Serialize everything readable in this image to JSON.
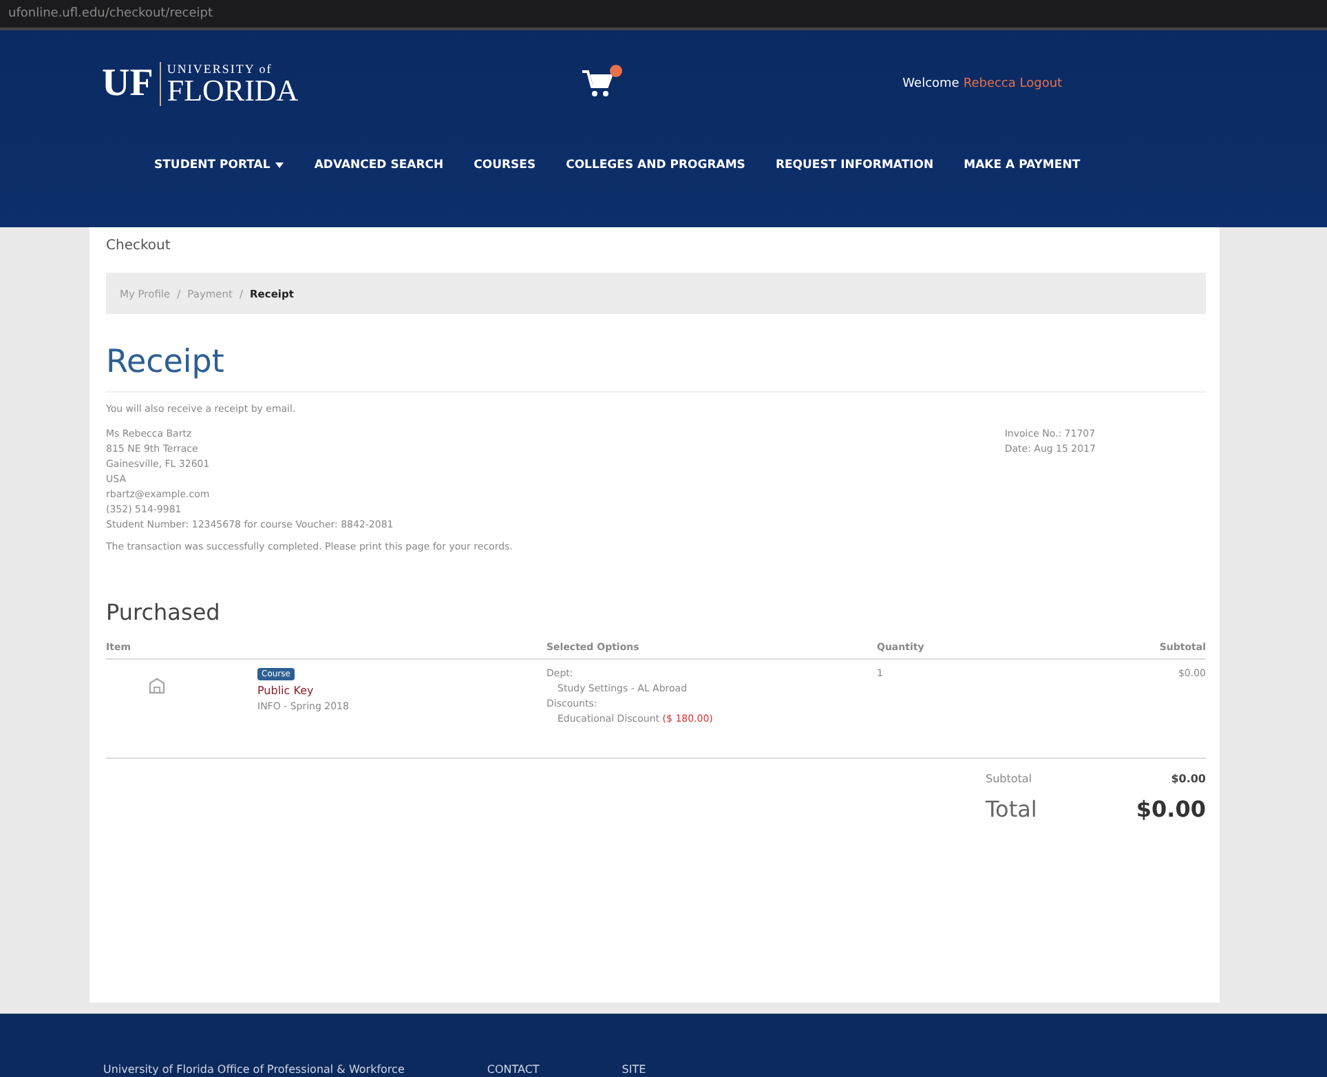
{
  "browser": {
    "address": "ufonline.ufl.edu/checkout/receipt"
  },
  "header": {
    "logo_mark": "UF",
    "logo_top": "UNIVERSITY of",
    "logo_bottom": "FLORIDA",
    "welcome": "Welcome",
    "user_link": "Rebecca Logout"
  },
  "nav": [
    {
      "label": "STUDENT PORTAL",
      "dropdown": true
    },
    {
      "label": "ADVANCED SEARCH",
      "dropdown": false
    },
    {
      "label": "COURSES",
      "dropdown": false
    },
    {
      "label": "COLLEGES AND PROGRAMS",
      "dropdown": false
    },
    {
      "label": "REQUEST INFORMATION",
      "dropdown": false
    },
    {
      "label": "MAKE A PAYMENT",
      "dropdown": false
    }
  ],
  "page_label": "Checkout",
  "breadcrumb_separator": "/",
  "breadcrumb": [
    {
      "label": "My Profile",
      "current": false
    },
    {
      "label": "Payment",
      "current": false
    },
    {
      "label": "Receipt",
      "current": true
    }
  ],
  "title": "Receipt",
  "notice": "You will also receive a receipt by email.",
  "address": [
    "Ms Rebecca Bartz",
    "815 NE 9th Terrace",
    "Gainesville, FL 32601",
    "USA",
    "rbartz@example.com",
    "(352) 514-9981",
    "Student Number: 12345678 for course Voucher: 8842-2081"
  ],
  "order": [
    "Invoice No.: 71707",
    "Date: Aug 15 2017"
  ],
  "confirmation": "The transaction was successfully completed. Please print this page for your records.",
  "purchased_title": "Purchased",
  "table": {
    "columns": [
      "Item",
      "Selected Options",
      "Quantity",
      "Subtotal"
    ],
    "rows": [
      {
        "badge": "Course",
        "name": "Public Key",
        "code": "INFO - Spring 2018",
        "option_label_1": "Dept:",
        "option_value_1": "Study Settings - AL Abroad",
        "option_label_2": "Discounts:",
        "option_value_2": "Educational Discount",
        "option_discount": "($ 180.00)",
        "quantity": "1",
        "subtotal": "$0.00"
      }
    ]
  },
  "totals": {
    "subtotal_label": "Subtotal",
    "subtotal": "$0.00",
    "total_label": "Total",
    "total": "$0.00"
  },
  "footer": [
    "University of Florida Office of Professional & Workforce",
    "CONTACT",
    "SITE"
  ]
}
